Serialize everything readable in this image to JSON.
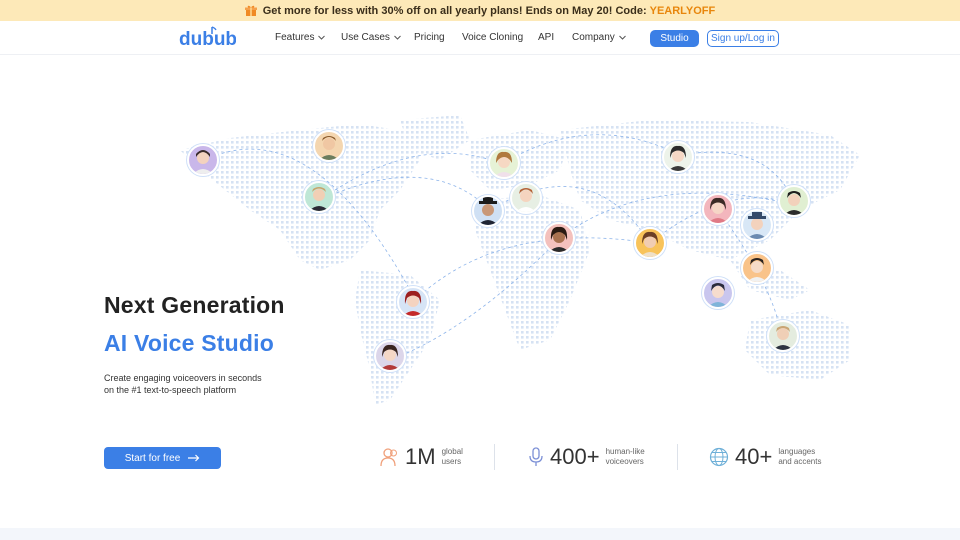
{
  "promo": {
    "text": "Get more for less with 30% off on all yearly plans! Ends on May 20! Code:",
    "code": "YEARLYOFF"
  },
  "nav": {
    "logo": "dubub",
    "items": [
      {
        "label": "Features",
        "dropdown": true
      },
      {
        "label": "Use Cases",
        "dropdown": true
      },
      {
        "label": "Pricing",
        "dropdown": false
      },
      {
        "label": "Voice Cloning",
        "dropdown": false
      },
      {
        "label": "API",
        "dropdown": false
      },
      {
        "label": "Company",
        "dropdown": true
      }
    ],
    "studio_label": "Studio",
    "sign_label": "Sign up/Log in"
  },
  "hero": {
    "headline": "Next Generation",
    "headline_accent": "AI Voice Studio",
    "subtitle_line1": "Create engaging voiceovers in seconds",
    "subtitle_line2": "on the #1 text-to-speech platform",
    "cta_label": "Start for free"
  },
  "stats": [
    {
      "icon": "users-icon",
      "value": "1M",
      "label_line1": "global",
      "label_line2": "users"
    },
    {
      "icon": "microphone-icon",
      "value": "400+",
      "label_line1": "human-like",
      "label_line2": "voiceovers"
    },
    {
      "icon": "globe-icon",
      "value": "40+",
      "label_line1": "languages",
      "label_line2": "and accents"
    }
  ],
  "colors": {
    "accent": "#3b7fe6",
    "promo_bg": "#fde9b8",
    "promo_code": "#e8860c",
    "map_dots": "#d6e2f3"
  }
}
